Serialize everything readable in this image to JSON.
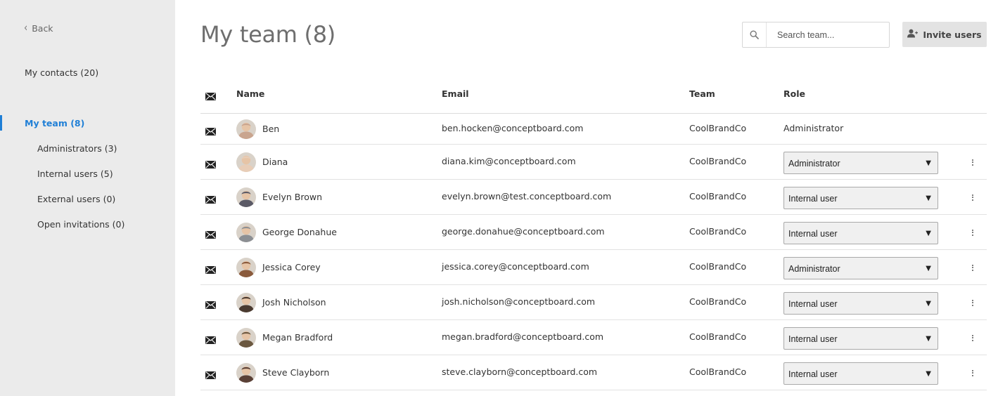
{
  "sidebar": {
    "back_label": "Back",
    "my_contacts": "My contacts (20)",
    "my_team": "My team (8)",
    "sub_items": [
      {
        "label": "Administrators (3)"
      },
      {
        "label": "Internal users (5)"
      },
      {
        "label": "External users (0)"
      },
      {
        "label": "Open invitations (0)"
      }
    ],
    "accent_color": "#1f7fd6"
  },
  "header": {
    "title": "My team (8)",
    "search_placeholder": "Search team...",
    "invite_label": "Invite users"
  },
  "table": {
    "columns": {
      "name": "Name",
      "email": "Email",
      "team": "Team",
      "role": "Role"
    },
    "rows": [
      {
        "name": "Ben",
        "email": "ben.hocken@conceptboard.com",
        "team": "CoolBrandCo",
        "role": "Administrator",
        "editable": false,
        "avatar_color": "#c9a58f"
      },
      {
        "name": "Diana",
        "email": "diana.kim@conceptboard.com",
        "team": "CoolBrandCo",
        "role": "Administrator",
        "editable": true,
        "avatar_color": "#e8cdb7"
      },
      {
        "name": "Evelyn Brown",
        "email": "evelyn.brown@test.conceptboard.com",
        "team": "CoolBrandCo",
        "role": "Internal user",
        "editable": true,
        "avatar_color": "#5b5a66"
      },
      {
        "name": "George Donahue",
        "email": "george.donahue@conceptboard.com",
        "team": "CoolBrandCo",
        "role": "Internal user",
        "editable": true,
        "avatar_color": "#8c8f93"
      },
      {
        "name": "Jessica Corey",
        "email": "jessica.corey@conceptboard.com",
        "team": "CoolBrandCo",
        "role": "Administrator",
        "editable": true,
        "avatar_color": "#8a5a3c"
      },
      {
        "name": "Josh Nicholson",
        "email": "josh.nicholson@conceptboard.com",
        "team": "CoolBrandCo",
        "role": "Internal user",
        "editable": true,
        "avatar_color": "#4a3a30"
      },
      {
        "name": "Megan Bradford",
        "email": "megan.bradford@conceptboard.com",
        "team": "CoolBrandCo",
        "role": "Internal user",
        "editable": true,
        "avatar_color": "#6b5840"
      },
      {
        "name": "Steve Clayborn",
        "email": "steve.clayborn@conceptboard.com",
        "team": "CoolBrandCo",
        "role": "Internal user",
        "editable": true,
        "avatar_color": "#5a4036"
      }
    ]
  }
}
